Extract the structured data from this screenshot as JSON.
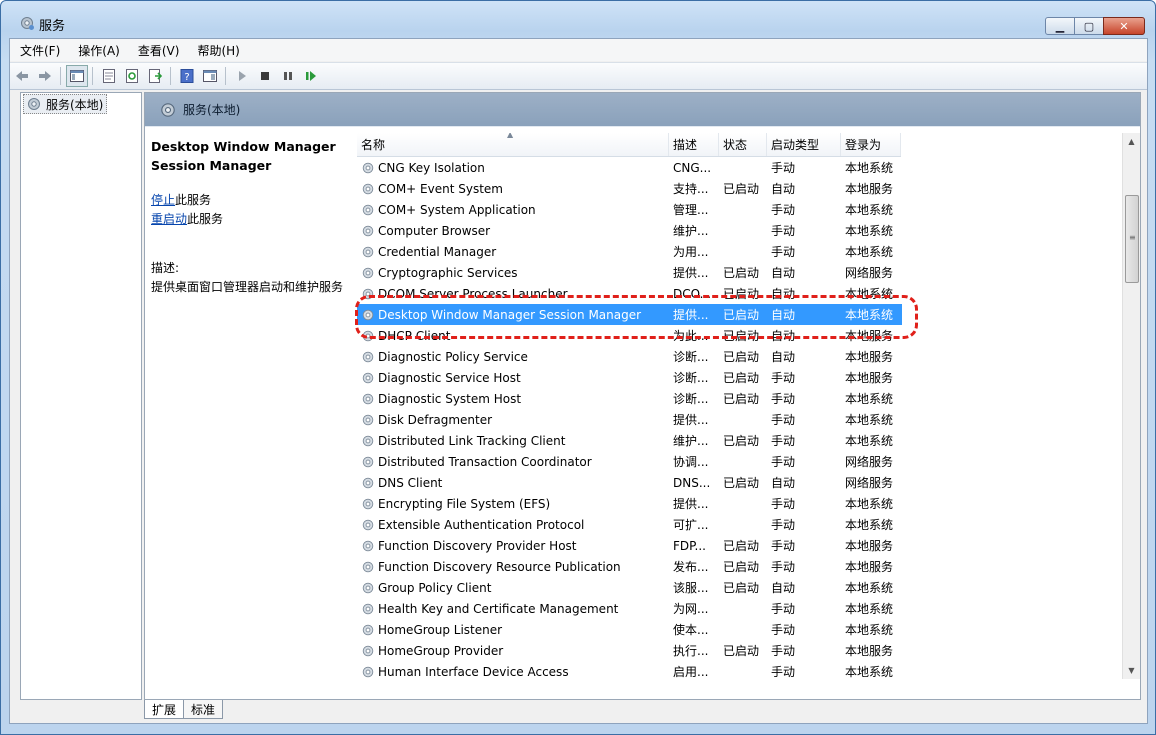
{
  "window": {
    "title": "服务",
    "min_label": "▭",
    "max_label": "▢",
    "close_label": "✕"
  },
  "menu": [
    "文件(F)",
    "操作(A)",
    "查看(V)",
    "帮助(H)"
  ],
  "tree": {
    "root": "服务(本地)"
  },
  "pane": {
    "title": "服务(本地)"
  },
  "details": {
    "service_name": "Desktop Window Manager Session Manager",
    "stop_link": "停止",
    "stop_suffix": "此服务",
    "restart_link": "重启动",
    "restart_suffix": "此服务",
    "desc_label": "描述:",
    "desc_text": "提供桌面窗口管理器启动和维护服务"
  },
  "columns": {
    "name": "名称",
    "desc": "描述",
    "status": "状态",
    "startup": "启动类型",
    "logon": "登录为"
  },
  "services": [
    {
      "name": "CNG Key Isolation",
      "desc": "CNG...",
      "status": "",
      "startup": "手动",
      "logon": "本地系统"
    },
    {
      "name": "COM+ Event System",
      "desc": "支持...",
      "status": "已启动",
      "startup": "自动",
      "logon": "本地服务"
    },
    {
      "name": "COM+ System Application",
      "desc": "管理...",
      "status": "",
      "startup": "手动",
      "logon": "本地系统"
    },
    {
      "name": "Computer Browser",
      "desc": "维护...",
      "status": "",
      "startup": "手动",
      "logon": "本地系统"
    },
    {
      "name": "Credential Manager",
      "desc": "为用...",
      "status": "",
      "startup": "手动",
      "logon": "本地系统"
    },
    {
      "name": "Cryptographic Services",
      "desc": "提供...",
      "status": "已启动",
      "startup": "自动",
      "logon": "网络服务"
    },
    {
      "name": "DCOM Server Process Launcher",
      "desc": "DCO...",
      "status": "已启动",
      "startup": "自动",
      "logon": "本地系统"
    },
    {
      "name": "Desktop Window Manager Session Manager",
      "desc": "提供...",
      "status": "已启动",
      "startup": "自动",
      "logon": "本地系统",
      "selected": true
    },
    {
      "name": "DHCP Client",
      "desc": "为此...",
      "status": "已启动",
      "startup": "自动",
      "logon": "本地服务"
    },
    {
      "name": "Diagnostic Policy Service",
      "desc": "诊断...",
      "status": "已启动",
      "startup": "自动",
      "logon": "本地服务"
    },
    {
      "name": "Diagnostic Service Host",
      "desc": "诊断...",
      "status": "已启动",
      "startup": "手动",
      "logon": "本地服务"
    },
    {
      "name": "Diagnostic System Host",
      "desc": "诊断...",
      "status": "已启动",
      "startup": "手动",
      "logon": "本地系统"
    },
    {
      "name": "Disk Defragmenter",
      "desc": "提供...",
      "status": "",
      "startup": "手动",
      "logon": "本地系统"
    },
    {
      "name": "Distributed Link Tracking Client",
      "desc": "维护...",
      "status": "已启动",
      "startup": "手动",
      "logon": "本地系统"
    },
    {
      "name": "Distributed Transaction Coordinator",
      "desc": "协调...",
      "status": "",
      "startup": "手动",
      "logon": "网络服务"
    },
    {
      "name": "DNS Client",
      "desc": "DNS...",
      "status": "已启动",
      "startup": "自动",
      "logon": "网络服务"
    },
    {
      "name": "Encrypting File System (EFS)",
      "desc": "提供...",
      "status": "",
      "startup": "手动",
      "logon": "本地系统"
    },
    {
      "name": "Extensible Authentication Protocol",
      "desc": "可扩...",
      "status": "",
      "startup": "手动",
      "logon": "本地系统"
    },
    {
      "name": "Function Discovery Provider Host",
      "desc": "FDP...",
      "status": "已启动",
      "startup": "手动",
      "logon": "本地服务"
    },
    {
      "name": "Function Discovery Resource Publication",
      "desc": "发布...",
      "status": "已启动",
      "startup": "手动",
      "logon": "本地服务"
    },
    {
      "name": "Group Policy Client",
      "desc": "该服...",
      "status": "已启动",
      "startup": "自动",
      "logon": "本地系统"
    },
    {
      "name": "Health Key and Certificate Management",
      "desc": "为网...",
      "status": "",
      "startup": "手动",
      "logon": "本地系统"
    },
    {
      "name": "HomeGroup Listener",
      "desc": "使本...",
      "status": "",
      "startup": "手动",
      "logon": "本地系统"
    },
    {
      "name": "HomeGroup Provider",
      "desc": "执行...",
      "status": "已启动",
      "startup": "手动",
      "logon": "本地服务"
    },
    {
      "name": "Human Interface Device Access",
      "desc": "启用...",
      "status": "",
      "startup": "手动",
      "logon": "本地系统"
    }
  ],
  "tabs": [
    "扩展",
    "标准"
  ],
  "colors": {
    "selection": "#3399ff",
    "highlight": "#e0201a",
    "link": "#0645ad"
  }
}
